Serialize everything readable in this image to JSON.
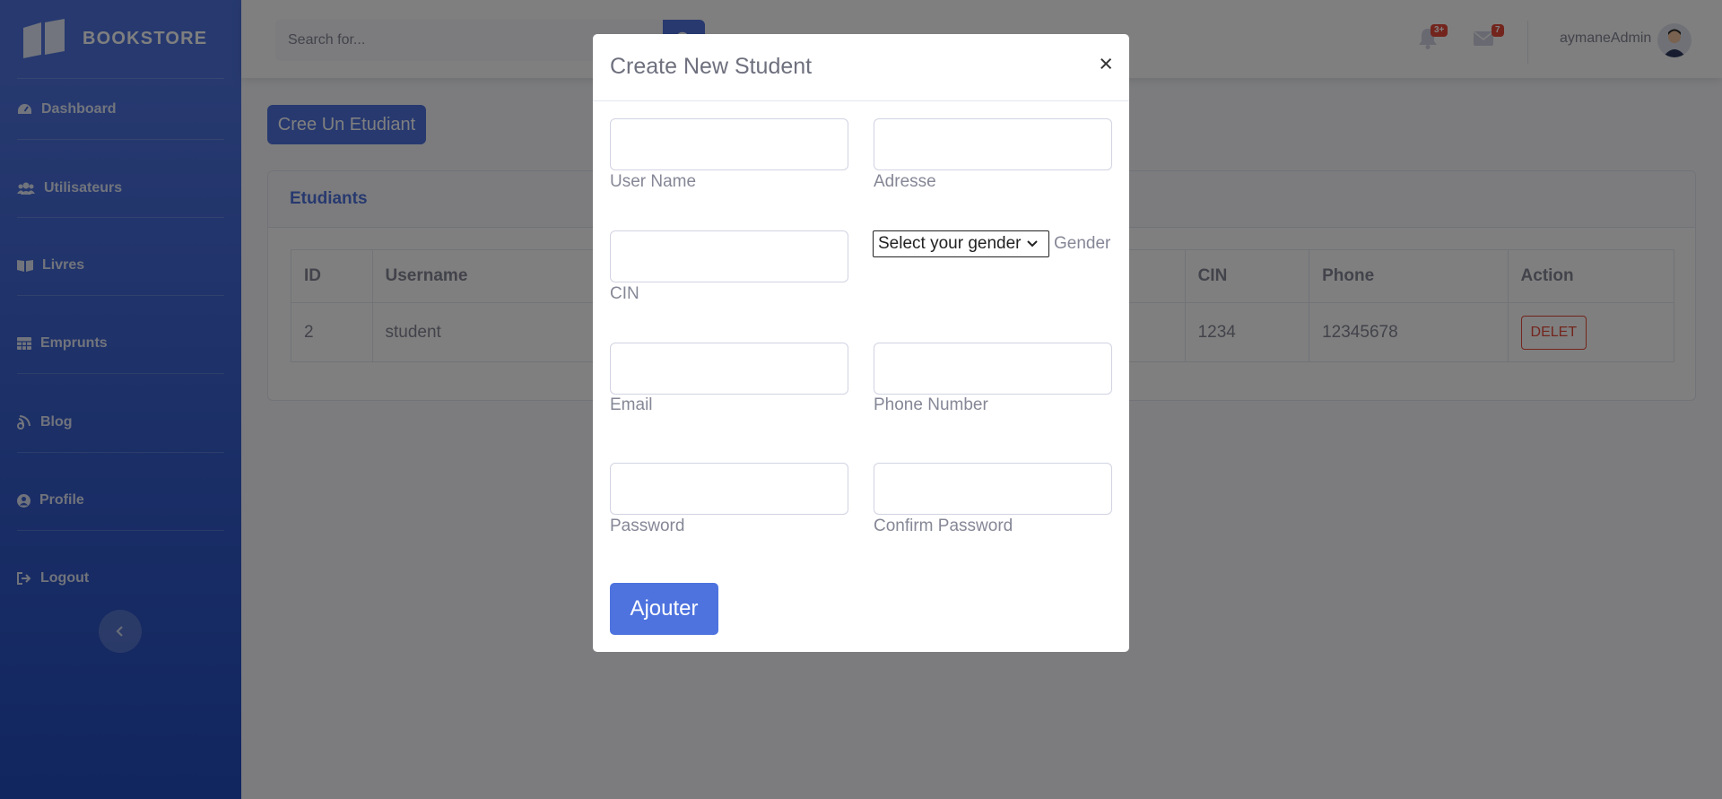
{
  "sidebar": {
    "brand": "BOOKSTORE",
    "items": [
      {
        "label": "Dashboard",
        "icon": "tachometer-icon"
      },
      {
        "label": "Utilisateurs",
        "icon": "users-icon"
      },
      {
        "label": "Livres",
        "icon": "book-open-icon"
      },
      {
        "label": "Emprunts",
        "icon": "table-icon"
      },
      {
        "label": "Blog",
        "icon": "blog-icon"
      },
      {
        "label": "Profile",
        "icon": "user-circle-icon"
      },
      {
        "label": "Logout",
        "icon": "sign-out-icon"
      }
    ]
  },
  "topbar": {
    "search_placeholder": "Search for...",
    "alerts_badge": "3+",
    "messages_badge": "7",
    "username": "aymaneAdmin"
  },
  "main": {
    "create_button": "Cree Un Etudiant",
    "card_title": "Etudiants",
    "table": {
      "columns": [
        "ID",
        "Username",
        "CIN",
        "Phone",
        "Action"
      ],
      "rows": [
        {
          "id": "2",
          "username": "student",
          "cin": "1234",
          "phone": "12345678",
          "action": "DELET"
        }
      ]
    }
  },
  "modal": {
    "title": "Create New Student",
    "close": "×",
    "fields": {
      "username": "User Name",
      "address": "Adresse",
      "cin": "CIN",
      "gender_select": "Select your gender",
      "gender_label": "Gender",
      "email": "Email",
      "phone": "Phone Number",
      "password": "Password",
      "confirm_password": "Confirm Password"
    },
    "submit": "Ajouter"
  },
  "colors": {
    "primary": "#4e73df",
    "danger": "#e74a3b",
    "sidebar_gradient_end": "#224abe"
  }
}
